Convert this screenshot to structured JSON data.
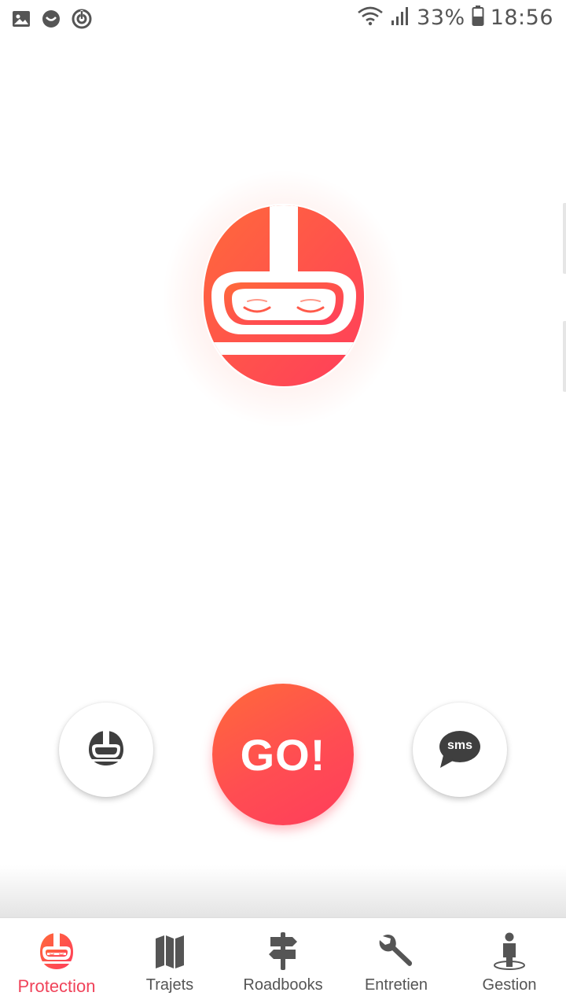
{
  "status_bar": {
    "battery": "33%",
    "time": "18:56",
    "icons": [
      "image-icon",
      "face-icon",
      "sync-icon",
      "wifi-icon",
      "signal-icon",
      "battery-icon"
    ]
  },
  "hero": {
    "icon": "helmet-icon",
    "colors": {
      "primary": "#ff4d52",
      "gradient_start": "#ff6a3a",
      "gradient_end": "#ff3d5c"
    }
  },
  "actions": {
    "helmet_icon": "helmet-icon",
    "go_label": "GO!",
    "sms_label": "sms"
  },
  "nav": {
    "active_color": "#f0435a",
    "items": [
      {
        "label": "Protection",
        "icon": "helmet-icon",
        "active": true
      },
      {
        "label": "Trajets",
        "icon": "map-icon",
        "active": false
      },
      {
        "label": "Roadbooks",
        "icon": "signpost-icon",
        "active": false
      },
      {
        "label": "Entretien",
        "icon": "wrench-icon",
        "active": false
      },
      {
        "label": "Gestion",
        "icon": "person-icon",
        "active": false
      }
    ]
  }
}
